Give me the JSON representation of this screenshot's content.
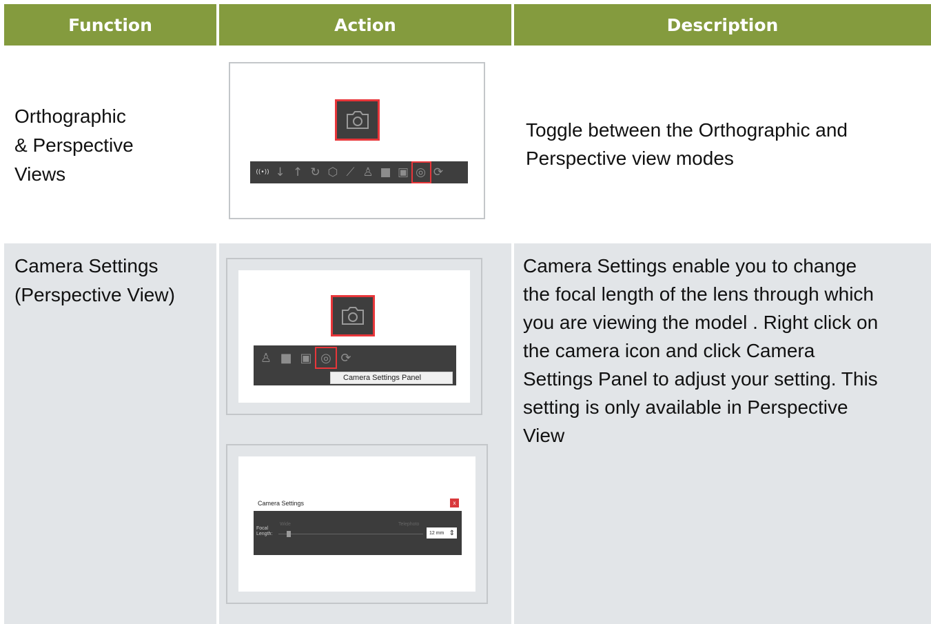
{
  "headers": {
    "function": "Function",
    "action": "Action",
    "description": "Description"
  },
  "colors": {
    "header_bg": "#849b3e",
    "row_alt_bg": "#e2e5e8",
    "highlight": "#e8363a",
    "toolbar_bg": "#3e3e3e"
  },
  "rows": [
    {
      "function_lines": [
        "Orthographic",
        "& Perspective",
        "Views"
      ],
      "description_lines": [
        "Toggle between the Orthographic and",
        "Perspective view modes"
      ],
      "toolbar_icons": [
        "signal-icon",
        "arrow-down-icon",
        "arrow-up-icon",
        "rotate-icon",
        "cube-outline-icon",
        "ruler-icon",
        "person-icon",
        "cube-solid-icon",
        "image-icon",
        "camera-icon",
        "camera-rotate-icon"
      ]
    },
    {
      "function_lines": [
        "Camera Settings",
        "(Perspective View)"
      ],
      "description_lines": [
        "Camera Settings enable you to change",
        "the focal length of the lens through which",
        "you are viewing the model . Right click on",
        "the camera icon and click Camera",
        "Settings Panel to adjust your setting. This",
        "setting is only available in Perspective",
        "View"
      ],
      "context_menu_item": "Camera Settings Panel",
      "dialog": {
        "title": "Camera Settings",
        "close": "x",
        "focal_label_1": "Focal",
        "focal_label_2": "Length:",
        "wide_label": "Wide",
        "telephoto_label": "Telephoto",
        "focal_value": "12 mm",
        "spinner": "⇕"
      }
    }
  ]
}
